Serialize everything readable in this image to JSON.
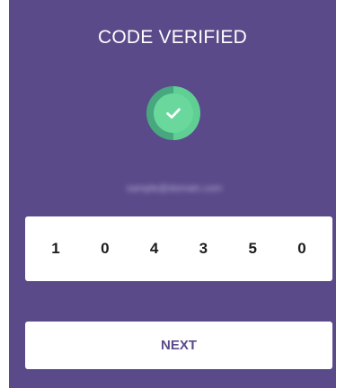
{
  "header": {
    "title": "CODE VERIFIED"
  },
  "status": {
    "icon": "check-circle-icon",
    "colors": {
      "ring_light": "#5fcf94",
      "ring_dark": "#47a880",
      "fill": "#6ad89c"
    }
  },
  "email": {
    "value": "sample@domain.com"
  },
  "code": {
    "digits": [
      "1",
      "0",
      "4",
      "3",
      "5",
      "0"
    ]
  },
  "actions": {
    "next_label": "NEXT"
  },
  "theme": {
    "background": "#5a4a8a",
    "surface": "#ffffff",
    "text_on_surface": "#1b1b1b"
  }
}
